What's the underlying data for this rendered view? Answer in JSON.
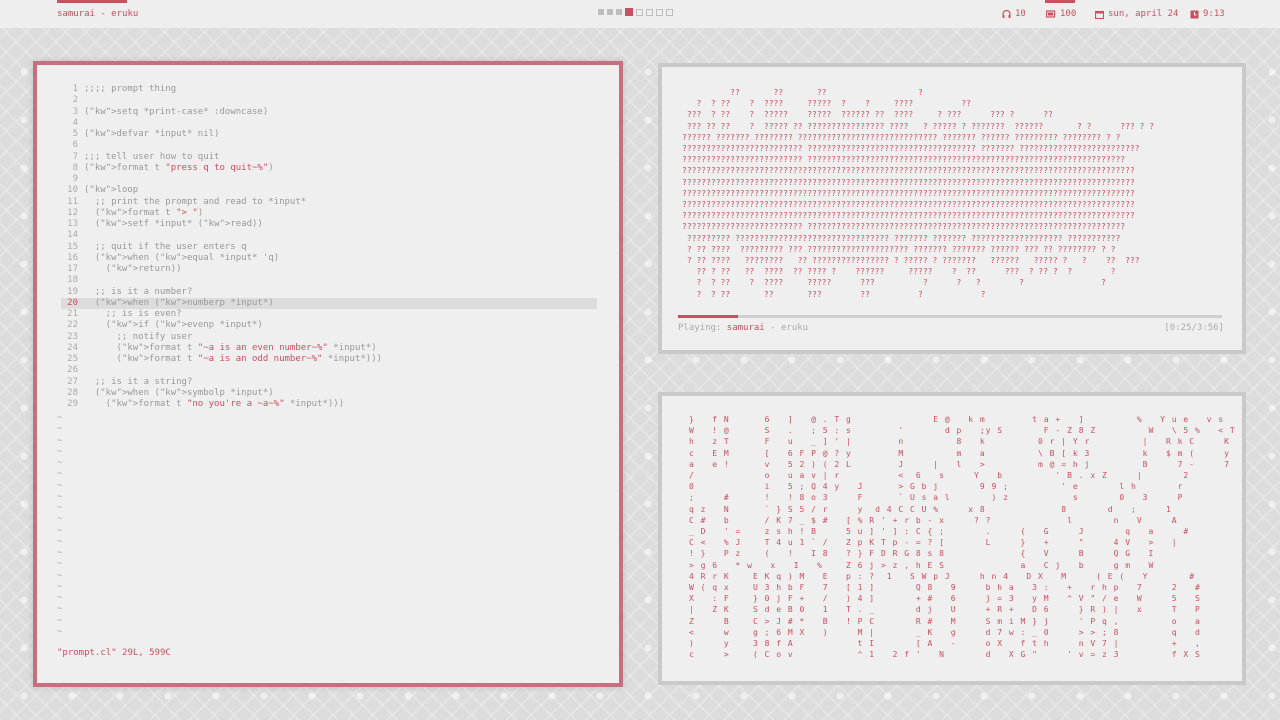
{
  "topbar": {
    "window_title": "samurai - eruku",
    "workspaces": [
      "1",
      "2",
      "3",
      "4",
      "5",
      "6",
      "7",
      "8"
    ],
    "active_workspace": 4,
    "headphones_icon": "headphones-icon",
    "volume": "10",
    "battery_icon": "battery-icon",
    "battery": "100",
    "calendar_icon": "calendar-icon",
    "date": "sun, april 24",
    "clock_icon": "clock-icon",
    "time": "9:13",
    "accent_color": "#c8505f"
  },
  "editor": {
    "lines": [
      {
        "n": "1",
        "text": ";;;; prompt thing"
      },
      {
        "n": "2",
        "text": ""
      },
      {
        "n": "3",
        "text": "(setq *print-case* :downcase)"
      },
      {
        "n": "4",
        "text": ""
      },
      {
        "n": "5",
        "text": "(defvar *input* nil)"
      },
      {
        "n": "6",
        "text": ""
      },
      {
        "n": "7",
        "text": ";;; tell user how to quit"
      },
      {
        "n": "8",
        "text": "(format t \"press q to quit~%\")"
      },
      {
        "n": "9",
        "text": ""
      },
      {
        "n": "10",
        "text": "(loop"
      },
      {
        "n": "11",
        "text": "  ;; print the prompt and read to *input*"
      },
      {
        "n": "12",
        "text": "  (format t \"> \")"
      },
      {
        "n": "13",
        "text": "  (setf *input* (read))"
      },
      {
        "n": "14",
        "text": ""
      },
      {
        "n": "15",
        "text": "  ;; quit if the user enters q"
      },
      {
        "n": "16",
        "text": "  (when (equal *input* 'q)"
      },
      {
        "n": "17",
        "text": "    (return))"
      },
      {
        "n": "18",
        "text": ""
      },
      {
        "n": "19",
        "text": "  ;; is it a number?"
      },
      {
        "n": "20",
        "text": "  (when (numberp *input*)"
      },
      {
        "n": "21",
        "text": "    ;; is is even?"
      },
      {
        "n": "22",
        "text": "    (if (evenp *input*)"
      },
      {
        "n": "23",
        "text": "      ;; notify user"
      },
      {
        "n": "24",
        "text": "      (format t \"~a is an even number~%\" *input*)"
      },
      {
        "n": "25",
        "text": "      (format t \"~a is an odd number~%\" *input*)))"
      },
      {
        "n": "26",
        "text": ""
      },
      {
        "n": "27",
        "text": "  ;; is it a string?"
      },
      {
        "n": "28",
        "text": "  (when (symbolp *input*)"
      },
      {
        "n": "29",
        "text": "    (format t \"no you're a ~a~%\" *input*)))"
      }
    ],
    "current_line": 20,
    "tildes": "~\n~\n~\n~\n~\n~\n~\n~\n~\n~\n~\n~\n~\n~\n~\n~\n~\n~\n~\n~",
    "status": "\"prompt.cl\" 29L, 599C"
  },
  "player": {
    "label": "Playing:",
    "song": "samurai",
    "separator": "-",
    "artist": "eruku",
    "time": "[0:25/3:56]",
    "progress": 0.11
  },
  "visualizer": {
    "text": "          ??       ??       ??                   ?\n   ?  ? ??    ?  ????     ?????  ?    ?     ????          ??\n ???  ? ??    ?  ?????    ?????  ?????? ??  ????     ? ???      ??? ?      ??\n ??? ?? ??    ?  ????? ?? ???????????????? ????   ? ????? ? ???????  ??????       ? ?      ??? ? ?\n?????? ??????? ???????? ????????????????????????????? ??????? ?????? ????????? ???????? ? ?\n????????????????????????? ??????????????????????????????????? ??????? ?????????????????????????\n????????????????????????? ??????????????????????????????????????????????????????????????????\n??????????????????????????????????????????????????????????????????????????????????????????????\n??????????????????????????????????????????????????????????????????????????????????????????????\n??????????????????????????????????????????????????????????????????????????????????????????????\n??????????????????????????????????????????????????????????????????????????????????????????????\n??????????????????????????????????????????????????????????????????????????????????????????????\n????????????????????????? ??????????????????????????????????????????????????????????????????\n ????????? ???????????????????????????????? ??????? ??????? ??????????????????? ???????????\n ? ?? ????  ????????? ??? ????????????????????? ??????? ??????? ?????? ??? ?? ???????? ? ?\n ? ?? ????   ????????   ?? ???????????????? ? ????? ? ???????   ??????   ????? ?   ?    ??  ???\n   ?? ? ??   ??  ????  ?? ???? ?    ??????     ?????    ?  ??      ???  ? ?? ?  ?        ?\n   ?  ? ??    ?  ????     ?????      ???          ?      ?   ?        ?                ?\n   ?  ? ??       ??       ???        ??          ?            ?"
  },
  "rain": {
    "text": "}   f N      6   ]   @ . T g              E @   k m        t a +   ]         %   Y u e   v s\nW   ! @      S   .   ; 5 : s        '       d p   ;y S       F - Z 8 Z         W   \\ 5 %   < T\nh   z T      F   u   _ ] ' |        n         8   k         0 r | Y r         |   R k C     K\nc   E M      [   6 F P @ ? y        M         m   a         \\ B [ k 3         k   $ m (     y\na   e !      v   5 2 ) ( 2 L        J     |   l   >         m @ = h j         B     7 -     7\n/            o   u a v | r          <  6   s     Y   b         ' B . x Z     |       2\n0            i   5 ; Q 4 y   J      > G b j       9 9 ;         ' e       l h       r\n;     #      !   ! 8 o 3     F      ` U s a l       ) z           s       0   3     P\nq z   N      ` } S 5 / r     y  d 4 C C U %     x 8             8       d   ;     1\nC #   b      / K 7 _ $ #   [ % R ' + r b - x     ? ?             l       n   V     A\n_ D   ' =    z s h ! B     5 u ] ' ] : C { ;       .     (   G     J       q   a     #\nC <   % J    T 4 u 1 ` /   Z p K T p - = ? [       L     }   +     \"     4 V   >   |\n! }   P z    (   !   I 8   ? } F D R G 8 s 8             {   V     B     Q G   I\n> g 6   * w   x   I   %    Z 6 j > z , h E S             a   C j   b     g m   W\n4 R r K    E K q ) M   E   p : ?  1   S W p J     h n 4   D X   M     ( E (   Y       #\nW ( q x    U 3 h b F   7   [ 1 ]       Q 8   9     b h a   3 :   +   r h p   7     2   #\nX   : F    } 0 j F +   /   ) 4 ]       + #   6     j = 3   y M   ^ V \" / e   W     5   S\n|   Z K    S d e B 0   1   T . _       d j   U     + R +   D 6     } R ) |   x     T   P\nZ     B    C > J # *   B   ! P C       R #   M     S m i M } j     ' P q ,         o   a\n<     w    g ; 6 M X   )     M |       _ K   g     d 7 w : _ 0     > > ; 8         q   d\n)     y    3 8 f A           t I       [ A   -     o X   f t h     n V 7 |         +   ,\nc     >    ( C o v           ^ 1   2 f '   N       d   X G \"     ' v = z 3         f X S"
  }
}
